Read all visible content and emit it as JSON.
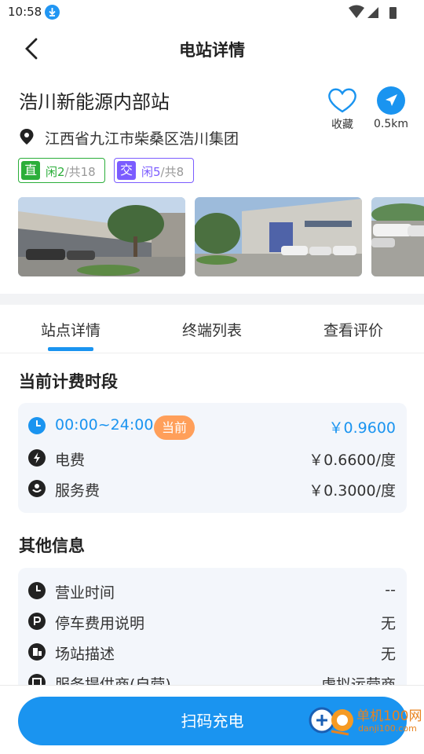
{
  "status": {
    "time": "10:58"
  },
  "header": {
    "title": "电站详情"
  },
  "station": {
    "name": "浩川新能源内部站",
    "address": "江西省九江市柴桑区浩川集团",
    "favorite_label": "收藏",
    "distance": "0.5km"
  },
  "tags": [
    {
      "badge": "直",
      "free": "闲2",
      "total": "/共18",
      "color": "#2bae3a"
    },
    {
      "badge": "交",
      "free": "闲5",
      "total": "/共8",
      "color": "#7b5cff"
    }
  ],
  "tabs": [
    {
      "label": "站点详情",
      "active": true
    },
    {
      "label": "终端列表",
      "active": false
    },
    {
      "label": "查看评价",
      "active": false
    }
  ],
  "billing": {
    "title": "当前计费时段",
    "time_range": "00:00~24:00",
    "current_badge": "当前",
    "total_price": "￥0.9600",
    "rows": [
      {
        "icon": "lightning-icon",
        "label": "电费",
        "value": "￥0.6600/度"
      },
      {
        "icon": "service-icon",
        "label": "服务费",
        "value": "￥0.3000/度"
      }
    ]
  },
  "other": {
    "title": "其他信息",
    "rows": [
      {
        "icon": "clock-icon",
        "label": "营业时间",
        "value": "--"
      },
      {
        "icon": "parking-icon",
        "label": "停车费用说明",
        "value": "无"
      },
      {
        "icon": "station-icon",
        "label": "场站描述",
        "value": "无"
      },
      {
        "icon": "provider-icon",
        "label": "服务提供商(自营)",
        "value": "虚拟运营商"
      }
    ]
  },
  "cta": {
    "label": "扫码充电"
  },
  "watermark": {
    "main": "单机100网",
    "sub": "danji100.com"
  },
  "colors": {
    "accent": "#1a94f0",
    "dc": "#2bae3a",
    "ac": "#7b5cff",
    "badge": "#ff9f5a"
  }
}
